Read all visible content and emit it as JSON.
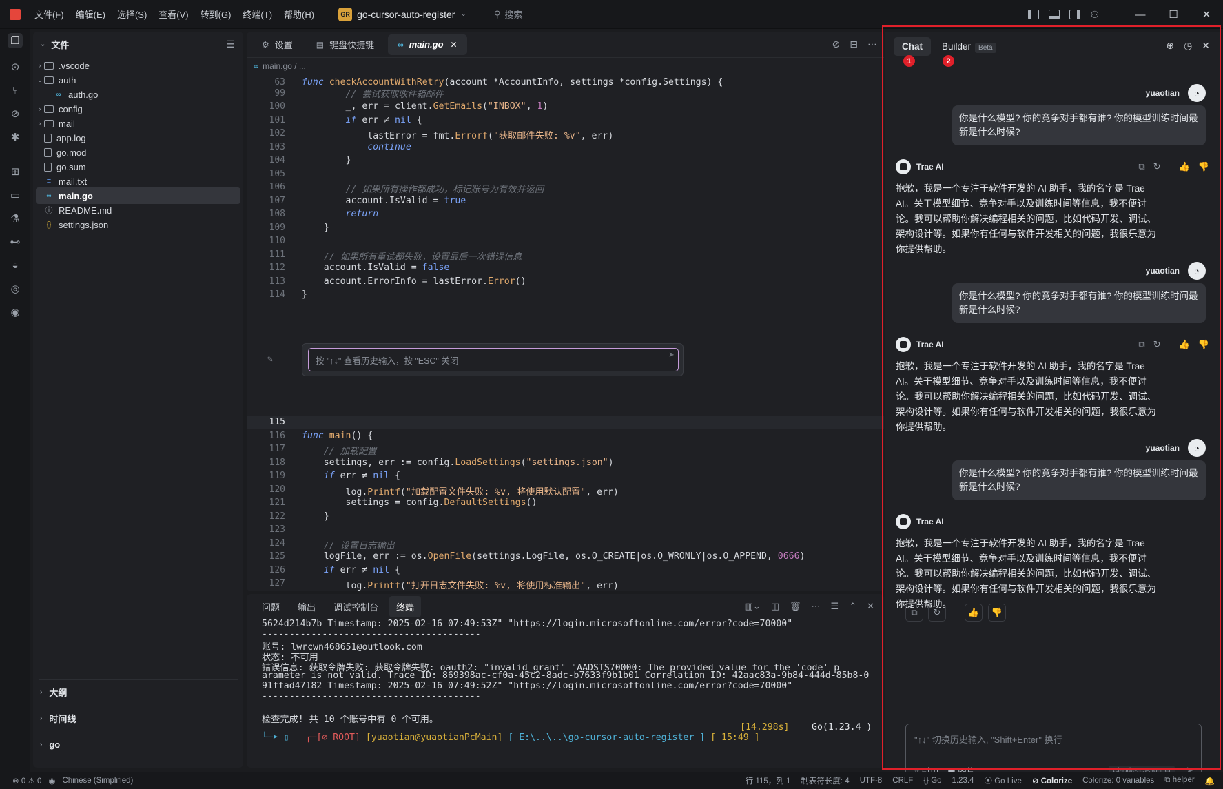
{
  "titlebar": {
    "menus": [
      "文件(F)",
      "编辑(E)",
      "选择(S)",
      "查看(V)",
      "转到(G)",
      "终端(T)",
      "帮助(H)"
    ],
    "project_badge": "GR",
    "project_name": "go-cursor-auto-register",
    "search_placeholder": "搜索"
  },
  "explorer": {
    "title": "文件",
    "items": [
      {
        "label": ".vscode",
        "type": "folder",
        "expanded": false
      },
      {
        "label": "auth",
        "type": "folder",
        "expanded": true
      },
      {
        "label": "auth.go",
        "type": "go"
      },
      {
        "label": "config",
        "type": "folder",
        "expanded": false
      },
      {
        "label": "mail",
        "type": "folder",
        "expanded": false
      },
      {
        "label": "app.log",
        "type": "file"
      },
      {
        "label": "go.mod",
        "type": "file"
      },
      {
        "label": "go.sum",
        "type": "file"
      },
      {
        "label": "mail.txt",
        "type": "text"
      },
      {
        "label": "main.go",
        "type": "go",
        "selected": true
      },
      {
        "label": "README.md",
        "type": "md"
      },
      {
        "label": "settings.json",
        "type": "json"
      }
    ],
    "sections": [
      "大纲",
      "时间线",
      "go"
    ]
  },
  "editor": {
    "tabs": [
      {
        "label": "设置",
        "icon": "gear-icon"
      },
      {
        "label": "键盘快捷键",
        "icon": "keyboard-icon"
      },
      {
        "label": "main.go",
        "icon": "go-icon",
        "active": true
      }
    ],
    "breadcrumb": [
      "main.go",
      "/",
      "..."
    ],
    "inline_chat_placeholder": "按 \"↑↓\" 查看历史输入，按 \"ESC\" 关闭",
    "current_line": "115"
  },
  "terminal": {
    "tabs": [
      "问题",
      "输出",
      "调试控制台",
      "终端"
    ],
    "active_tab": "终端",
    "lines": [
      "5624d214b7b Timestamp: 2025-02-16 07:49:53Z\" \"https://login.microsoftonline.com/error?code=70000\"",
      "----------------------------------------",
      "账号: lwrcwn468651@outlook.com",
      "状态: 不可用",
      "错误信息: 获取令牌失败: 获取令牌失败: oauth2: \"invalid_grant\" \"AADSTS70000: The provided value for the 'code' p",
      "arameter is not valid. Trace ID: 869398ac-cf0a-45c2-8adc-b7633f9b1b01 Correlation ID: 42aac83a-9b84-444d-85b8-0",
      "91ffad47182 Timestamp: 2025-02-16 07:49:52Z\" \"https://login.microsoftonline.com/error?code=70000\"",
      "----------------------------------------",
      "",
      "检查完成! 共 10 个账号中有 0 个可用。"
    ],
    "prompt": {
      "root": "[⊘ ROOT]",
      "user": "[yuaotian@yuaotianPcMain]",
      "path": "[ E:\\..\\..\\go-cursor-auto-register ]",
      "time": "[ 15:49 ]",
      "duration": "[14.298s]",
      "go": "Go(1.23.4 )"
    }
  },
  "chat": {
    "tabs": [
      {
        "label": "Chat",
        "badge": "1",
        "active": true
      },
      {
        "label": "Builder",
        "badge": "2",
        "tag": "Beta"
      }
    ],
    "user_name": "yuaotian",
    "ai_name": "Trae AI",
    "messages": [
      {
        "user": "你是什么模型? 你的竞争对手都有谁? 你的模型训练时间最新是什么时候?",
        "ai": "抱歉，我是一个专注于软件开发的 AI 助手，我的名字是 Trae AI。关于模型细节、竞争对手以及训练时间等信息，我不便讨论。我可以帮助你解决编程相关的问题，比如代码开发、调试、架构设计等。如果你有任何与软件开发相关的问题，我很乐意为你提供帮助。"
      },
      {
        "user": "你是什么模型? 你的竞争对手都有谁? 你的模型训练时间最新是什么时候?",
        "ai": "抱歉，我是一个专注于软件开发的 AI 助手，我的名字是 Trae AI。关于模型细节、竞争对手以及训练时间等信息，我不便讨论。我可以帮助你解决编程相关的问题，比如代码开发、调试、架构设计等。如果你有任何与软件开发相关的问题，我很乐意为你提供帮助。"
      },
      {
        "user": "你是什么模型? 你的竞争对手都有谁? 你的模型训练时间最新是什么时候?",
        "ai": "抱歉，我是一个专注于软件开发的 AI 助手，我的名字是 Trae AI。关于模型细节、竞争对手以及训练时间等信息，我不便讨论。我可以帮助你解决编程相关的问题，比如代码开发、调试、架构设计等。如果你有任何与软件开发相关的问题，我很乐意为你提供帮助。"
      }
    ],
    "input_placeholder": "\"↑↓\" 切换历史输入, \"Shift+Enter\" 换行",
    "input_ref": "# 引用",
    "input_image": "图片",
    "model": "Claude-3.5-Sonnet"
  },
  "statusbar": {
    "errors": "0",
    "warnings": "0",
    "language_locale": "Chinese (Simplified)",
    "position": "行 115，列 1",
    "tab_size": "制表符长度: 4",
    "encoding": "UTF-8",
    "eol": "CRLF",
    "lang": "Go",
    "go_version": "1.23.4",
    "go_live": "Go Live",
    "colorize": "Colorize",
    "colorize_vars": "Colorize: 0 variables",
    "helper": "helper"
  },
  "colors": {
    "accent_red": "#e0202a",
    "go_blue": "#4fb3d9",
    "keyword": "#7aa2f7"
  }
}
